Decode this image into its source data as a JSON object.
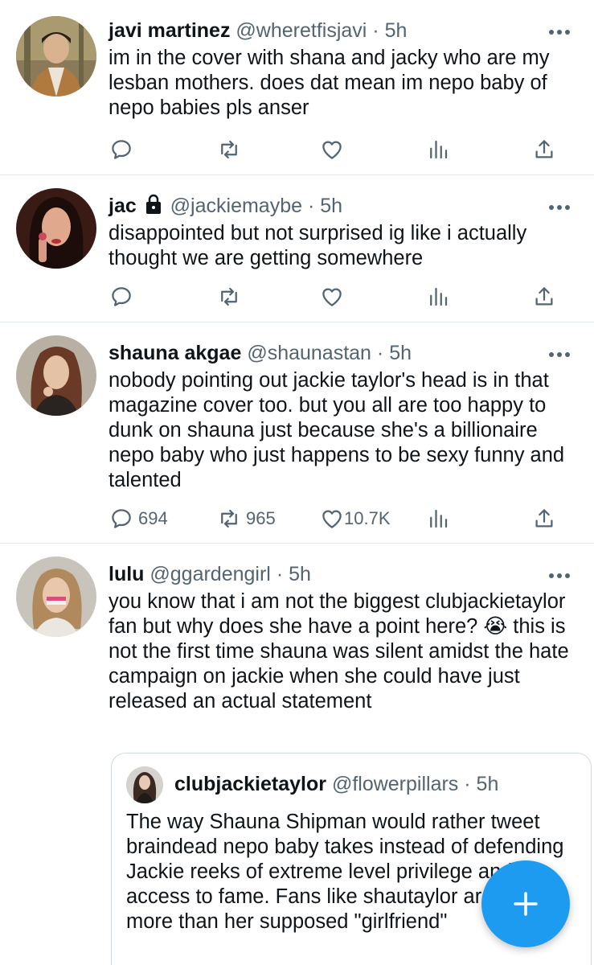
{
  "tweets": [
    {
      "name": "javi martinez",
      "handle": "@wheretfisjavi",
      "time": "5h",
      "text": "im in the cover with shana and jacky who are my lesban mothers. does dat mean im nepo baby of nepo babies pls anser",
      "locked": false,
      "counts": {
        "replies": "",
        "retweets": "",
        "likes": ""
      }
    },
    {
      "name": "jac",
      "handle": "@jackiemaybe",
      "time": "5h",
      "text": "disappointed but not surprised ig like i actually thought we are getting somewhere",
      "locked": true,
      "counts": {
        "replies": "",
        "retweets": "",
        "likes": ""
      }
    },
    {
      "name": "shauna akgae",
      "handle": "@shaunastan",
      "time": "5h",
      "text": "nobody pointing out jackie taylor's head is in that magazine cover too. but you all are too happy to dunk on shauna just because she's a billionaire nepo baby who just happens to be sexy funny and talented",
      "locked": false,
      "counts": {
        "replies": "694",
        "retweets": "965",
        "likes": "10.7K"
      }
    },
    {
      "name": "lulu",
      "handle": "@ggardengirl",
      "time": "5h",
      "text": "you know that i am not the biggest clubjackietaylor fan but why does she have a point here? 😭 this is not the first time shauna was silent amidst the hate campaign on jackie when she could have just released an actual statement",
      "locked": false
    }
  ],
  "quote": {
    "name": "clubjackietaylor",
    "handle": "@flowerpillars",
    "time": "5h",
    "text": "The way Shauna Shipman would rather tweet braindead nepo baby takes instead of defending Jackie reeks of extreme level privilege and access to fame. Fans like shautaylor are doing more than her supposed \"girlfriend\""
  },
  "separator": "·",
  "colors": {
    "accent": "#1d9bf0",
    "muted": "#536471",
    "text": "#0f1419",
    "border": "#e1e8ed"
  },
  "icons": [
    "more-icon",
    "lock-icon",
    "reply-icon",
    "retweet-icon",
    "like-icon",
    "analytics-icon",
    "share-icon",
    "compose-plus-icon"
  ]
}
